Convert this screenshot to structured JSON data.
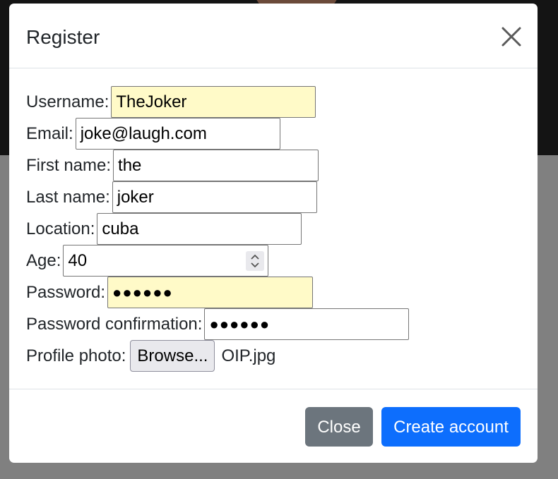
{
  "modal": {
    "title": "Register",
    "close_icon": "close-icon"
  },
  "form": {
    "username": {
      "label": "Username:",
      "value": "TheJoker"
    },
    "email": {
      "label": "Email:",
      "value": "joke@laugh.com"
    },
    "first_name": {
      "label": "First name:",
      "value": "the"
    },
    "last_name": {
      "label": "Last name:",
      "value": "joker"
    },
    "location": {
      "label": "Location:",
      "value": "cuba"
    },
    "age": {
      "label": "Age:",
      "value": "40"
    },
    "password": {
      "label": "Password:",
      "value": "●●●●●●"
    },
    "password_confirmation": {
      "label": "Password confirmation:",
      "value": "●●●●●●"
    },
    "profile_photo": {
      "label": "Profile photo:",
      "button_label": "Browse...",
      "file_name": "OIP.jpg"
    }
  },
  "footer": {
    "close_label": "Close",
    "create_label": "Create account"
  },
  "colors": {
    "primary": "#0d6efd",
    "secondary": "#6c757d",
    "autofill": "#fffac8"
  }
}
